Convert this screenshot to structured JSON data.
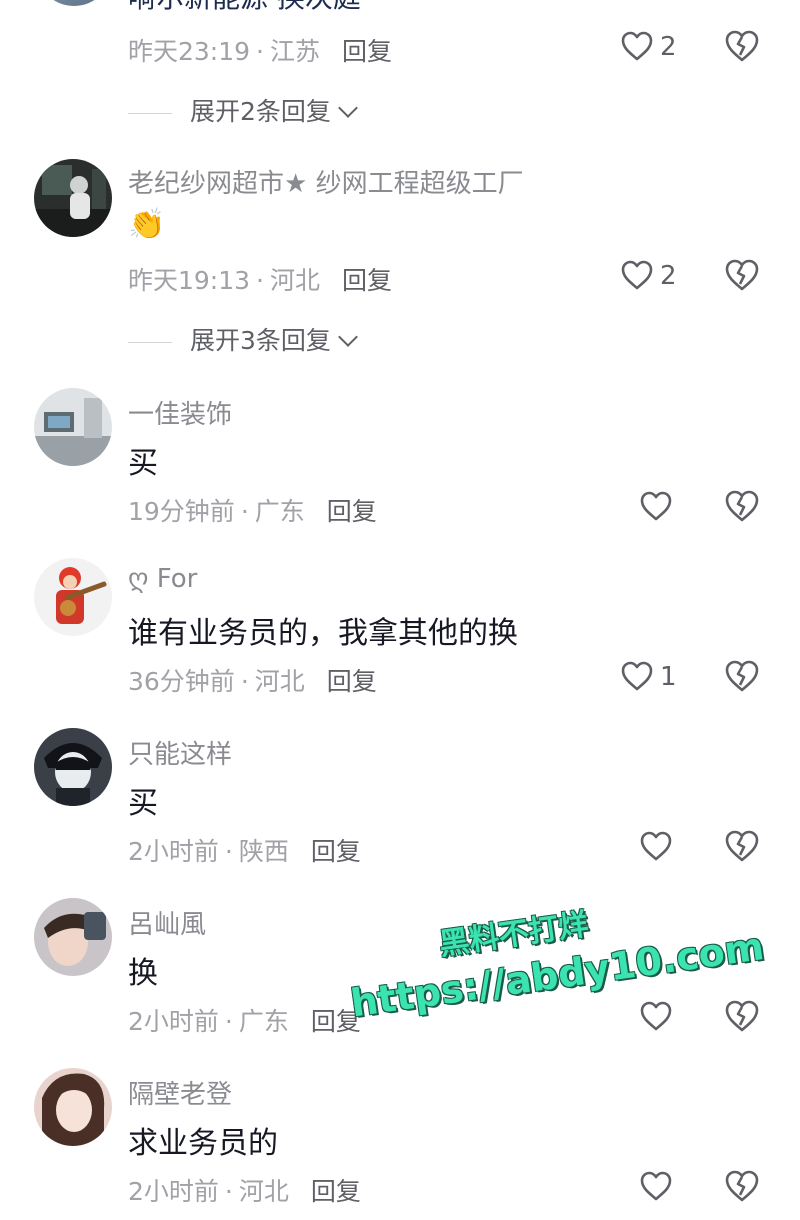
{
  "top_partial": {
    "text": "嗬尔新能源 换次庭"
  },
  "comments": [
    {
      "id": "c1",
      "username": "",
      "time": "昨天23:19",
      "location": "江苏",
      "reply_label": "回复",
      "likes": "2",
      "expand": "展开2条回复"
    },
    {
      "id": "c2",
      "username": "老纪纱网超市★ 纱网工程超级工厂",
      "content": "👏",
      "time": "昨天19:13",
      "location": "河北",
      "reply_label": "回复",
      "likes": "2",
      "expand": "展开3条回复"
    },
    {
      "id": "c3",
      "username": "一佳装饰",
      "content": "买",
      "time": "19分钟前",
      "location": "广东",
      "reply_label": "回复",
      "likes": ""
    },
    {
      "id": "c4",
      "username": "ღ For",
      "content": "谁有业务员的，我拿其他的换",
      "time": "36分钟前",
      "location": "河北",
      "reply_label": "回复",
      "likes": "1"
    },
    {
      "id": "c5",
      "username": "只能这样",
      "content": "买",
      "time": "2小时前",
      "location": "陕西",
      "reply_label": "回复",
      "likes": ""
    },
    {
      "id": "c6",
      "username": "呂屾風",
      "content": "换",
      "time": "2小时前",
      "location": "广东",
      "reply_label": "回复",
      "likes": ""
    },
    {
      "id": "c7",
      "username": "隔壁老登",
      "content": "求业务员的",
      "time": "2小时前",
      "location": "河北",
      "reply_label": "回复",
      "likes": ""
    }
  ],
  "separator": "·",
  "watermark": {
    "line1": "黑料不打烊",
    "line2": "https://abdy10.com"
  },
  "colors": {
    "username": "#8a8b91",
    "meta": "#a1a2a7",
    "content": "#161823",
    "watermark": "#3be3b0"
  }
}
